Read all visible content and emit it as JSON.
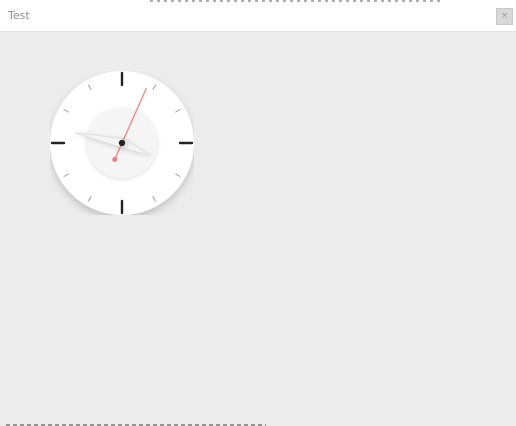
{
  "window": {
    "title": "Test",
    "close_glyph": "×"
  },
  "clock": {
    "time": {
      "hour": 3,
      "minute": 47,
      "second": 4
    },
    "colors": {
      "face": "#ffffff",
      "inner_face": "#f5f5f5",
      "ticks": "#222222",
      "minor_ticks": "#9a9a9a",
      "hands": "#f4f4f4",
      "second_hand": "#f07878",
      "center_dot": "#222222"
    }
  }
}
